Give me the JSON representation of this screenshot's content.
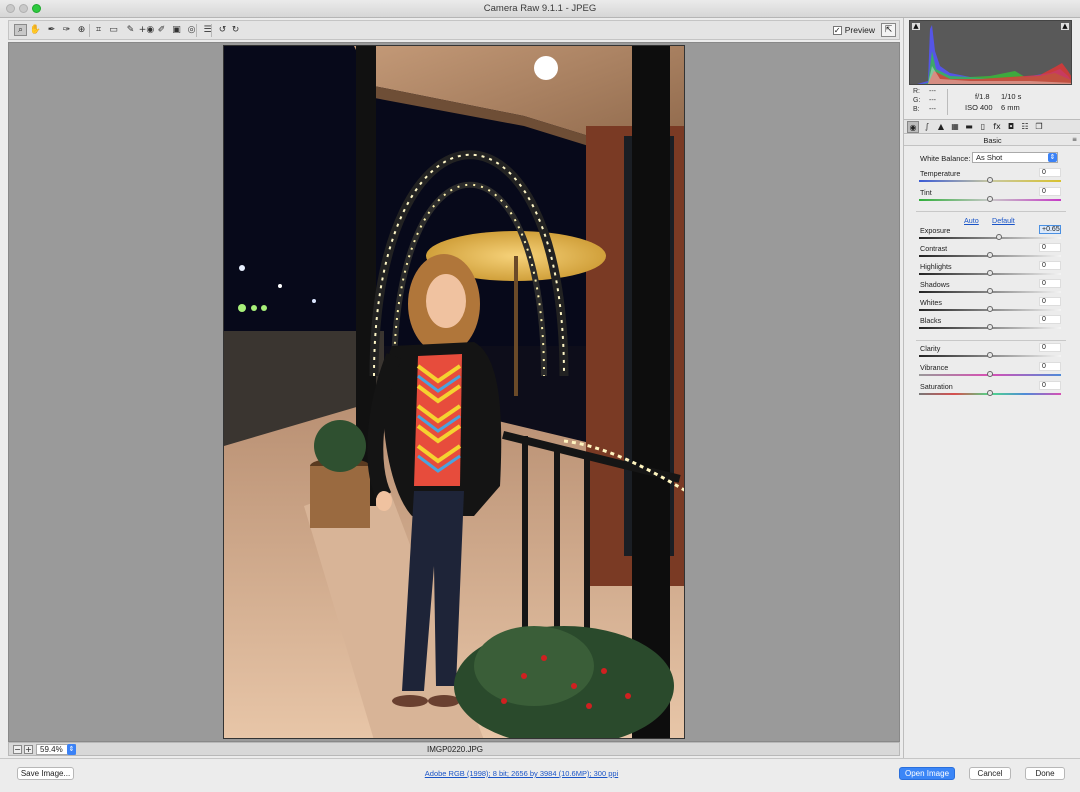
{
  "window": {
    "title": "Camera Raw 9.1.1  -  JPEG"
  },
  "toolbar": {
    "tools": [
      {
        "name": "zoom-tool",
        "icon": "magnifier-icon",
        "glyph": "⌕"
      },
      {
        "name": "hand-tool",
        "icon": "hand-icon",
        "glyph": "✋"
      },
      {
        "name": "white-balance-tool",
        "icon": "eyedropper-icon",
        "glyph": "✒"
      },
      {
        "name": "color-sampler-tool",
        "icon": "color-sampler-icon",
        "glyph": "✑"
      },
      {
        "name": "targeted-adjustment-tool",
        "icon": "target-adjust-icon",
        "glyph": "⊕"
      },
      {
        "name": "crop-tool",
        "icon": "crop-icon",
        "glyph": "⌗"
      },
      {
        "name": "straighten-tool",
        "icon": "straighten-icon",
        "glyph": "▭"
      },
      {
        "name": "spot-removal-tool",
        "icon": "spot-removal-icon",
        "glyph": "✎"
      },
      {
        "name": "red-eye-tool",
        "icon": "red-eye-icon",
        "glyph": "+◉"
      },
      {
        "name": "adjustment-brush-tool",
        "icon": "brush-icon",
        "glyph": "✐"
      },
      {
        "name": "graduated-filter-tool",
        "icon": "graduated-filter-icon",
        "glyph": "▣"
      },
      {
        "name": "radial-filter-tool",
        "icon": "radial-filter-icon",
        "glyph": "◎"
      },
      {
        "name": "preferences-tool",
        "icon": "list-icon",
        "glyph": "☰"
      },
      {
        "name": "rotate-ccw-tool",
        "icon": "rotate-left-icon",
        "glyph": "↺"
      },
      {
        "name": "rotate-cw-tool",
        "icon": "rotate-right-icon",
        "glyph": "↻"
      }
    ],
    "preview_label": "Preview",
    "preview_checked": true,
    "preview_checkmark": "✓",
    "fullscreen_glyph": "⇱"
  },
  "status": {
    "zoom_out_glyph": "−",
    "zoom_in_glyph": "+",
    "zoom": "59.4%",
    "zoom_arrow": "⇕",
    "filename": "IMGP0220.JPG"
  },
  "histogram": {
    "shadow_clip_glyph": "▲",
    "highlight_clip_glyph": "▲",
    "rgb_labels": [
      "R:",
      "G:",
      "B:"
    ],
    "rgb_values": [
      "---",
      "---",
      "---"
    ],
    "aperture": "f/1.8",
    "shutter": "1/10 s",
    "iso": "ISO 400",
    "focal_length": "6 mm",
    "colors": {
      "red": "#e33",
      "green": "#3c3",
      "blue": "#55f",
      "luma": "#ffffff"
    }
  },
  "panel": {
    "tabs": [
      {
        "name": "tab-basic",
        "icon": "aperture-icon",
        "glyph": "◉"
      },
      {
        "name": "tab-tone-curve",
        "icon": "tone-curve-icon",
        "glyph": "∫"
      },
      {
        "name": "tab-detail",
        "icon": "detail-icon",
        "glyph": "▲"
      },
      {
        "name": "tab-hsl",
        "icon": "hsl-icon",
        "glyph": "▦"
      },
      {
        "name": "tab-split-toning",
        "icon": "split-toning-icon",
        "glyph": "▬"
      },
      {
        "name": "tab-lens",
        "icon": "lens-icon",
        "glyph": "▯"
      },
      {
        "name": "tab-effects",
        "icon": "fx-icon",
        "glyph": "fx"
      },
      {
        "name": "tab-camera-calibration",
        "icon": "camera-icon",
        "glyph": "◘"
      },
      {
        "name": "tab-presets",
        "icon": "presets-icon",
        "glyph": "☷"
      },
      {
        "name": "tab-snapshots",
        "icon": "snapshots-icon",
        "glyph": "❐"
      }
    ],
    "title": "Basic",
    "menu_glyph": "≡",
    "white_balance_label": "White Balance:",
    "white_balance_value": "As Shot",
    "white_balance_arrow": "⇕",
    "auto_link": "Auto",
    "default_link": "Default",
    "sliders": [
      {
        "name": "temperature",
        "label": "Temperature",
        "value": "0",
        "position": 0.5,
        "track": "temperature"
      },
      {
        "name": "tint",
        "label": "Tint",
        "value": "0",
        "position": 0.5,
        "track": "tint"
      },
      {
        "name": "exposure",
        "label": "Exposure",
        "value": "+0.65",
        "position": 0.565,
        "track": "gray",
        "focused": true
      },
      {
        "name": "contrast",
        "label": "Contrast",
        "value": "0",
        "position": 0.5,
        "track": "gray"
      },
      {
        "name": "highlights",
        "label": "Highlights",
        "value": "0",
        "position": 0.5,
        "track": "gray"
      },
      {
        "name": "shadows",
        "label": "Shadows",
        "value": "0",
        "position": 0.5,
        "track": "gray"
      },
      {
        "name": "whites",
        "label": "Whites",
        "value": "0",
        "position": 0.5,
        "track": "gray"
      },
      {
        "name": "blacks",
        "label": "Blacks",
        "value": "0",
        "position": 0.5,
        "track": "gray"
      },
      {
        "name": "clarity",
        "label": "Clarity",
        "value": "0",
        "position": 0.5,
        "track": "gray"
      },
      {
        "name": "vibrance",
        "label": "Vibrance",
        "value": "0",
        "position": 0.5,
        "track": "vibrance"
      },
      {
        "name": "saturation",
        "label": "Saturation",
        "value": "0",
        "position": 0.5,
        "track": "saturation"
      }
    ]
  },
  "footer": {
    "save_image": "Save Image...",
    "workflow_options": "Adobe RGB (1998); 8 bit; 2656 by 3984 (10.6MP); 300 ppi",
    "open_image": "Open Image",
    "cancel": "Cancel",
    "done": "Done"
  }
}
